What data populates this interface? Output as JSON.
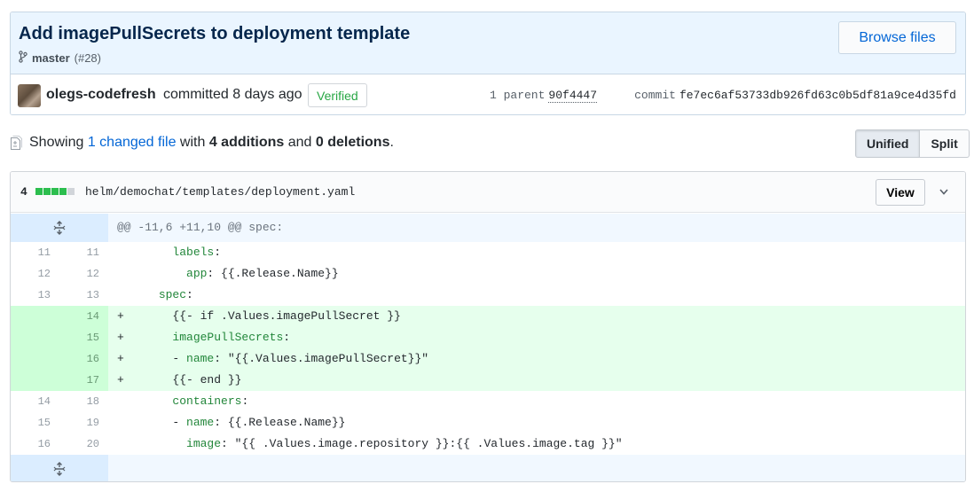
{
  "commit": {
    "title": "Add imagePullSecrets to deployment template",
    "branch": "master",
    "pr_ref": "(#28)",
    "browse_label": "Browse files",
    "author": "olegs-codefresh",
    "committed_text": "committed 8 days ago",
    "verified_label": "Verified",
    "parent_label": "1 parent",
    "parent_sha": "90f4447",
    "commit_label": "commit",
    "commit_sha": "fe7ec6af53733db926fd63c0b5df81a9ce4d35fd"
  },
  "summary": {
    "showing": "Showing",
    "changed_link": "1 changed file",
    "with": "with",
    "additions": "4 additions",
    "and": "and",
    "deletions": "0 deletions",
    "period": "."
  },
  "view_toggle": {
    "unified": "Unified",
    "split": "Split",
    "selected": "Unified"
  },
  "file": {
    "changes": "4",
    "diffstat": {
      "added_blocks": 4,
      "neutral_blocks": 1
    },
    "path": "helm/demochat/templates/deployment.yaml",
    "view_label": "View",
    "hunk_header": "@@ -11,6 +11,10 @@ spec:",
    "lines": [
      {
        "old": "11",
        "new": "11",
        "type": "context",
        "text": "        labels:"
      },
      {
        "old": "12",
        "new": "12",
        "type": "context",
        "text": "          app: {{.Release.Name}}"
      },
      {
        "old": "13",
        "new": "13",
        "type": "context",
        "text": "      spec:"
      },
      {
        "old": "",
        "new": "14",
        "type": "add",
        "text": "+       {{- if .Values.imagePullSecret }}"
      },
      {
        "old": "",
        "new": "15",
        "type": "add",
        "text": "+       imagePullSecrets:"
      },
      {
        "old": "",
        "new": "16",
        "type": "add",
        "text": "+       - name: \"{{.Values.imagePullSecret}}\""
      },
      {
        "old": "",
        "new": "17",
        "type": "add",
        "text": "+       {{- end }}"
      },
      {
        "old": "14",
        "new": "18",
        "type": "context",
        "text": "        containers:"
      },
      {
        "old": "15",
        "new": "19",
        "type": "context",
        "text": "        - name: {{.Release.Name}}"
      },
      {
        "old": "16",
        "new": "20",
        "type": "context",
        "text": "          image: \"{{ .Values.image.repository }}:{{ .Values.image.tag }}\""
      }
    ]
  },
  "icons": {
    "branch": "git-branch-icon",
    "file": "file-diff-icon",
    "expand": "unfold-icon",
    "chevron": "chevron-down-icon"
  },
  "colors": {
    "link": "#0366d6",
    "added_bg": "#e6ffed",
    "added_ln_bg": "#cdffd8",
    "hunk_bg": "#f1f8ff",
    "verified": "#28a745"
  }
}
